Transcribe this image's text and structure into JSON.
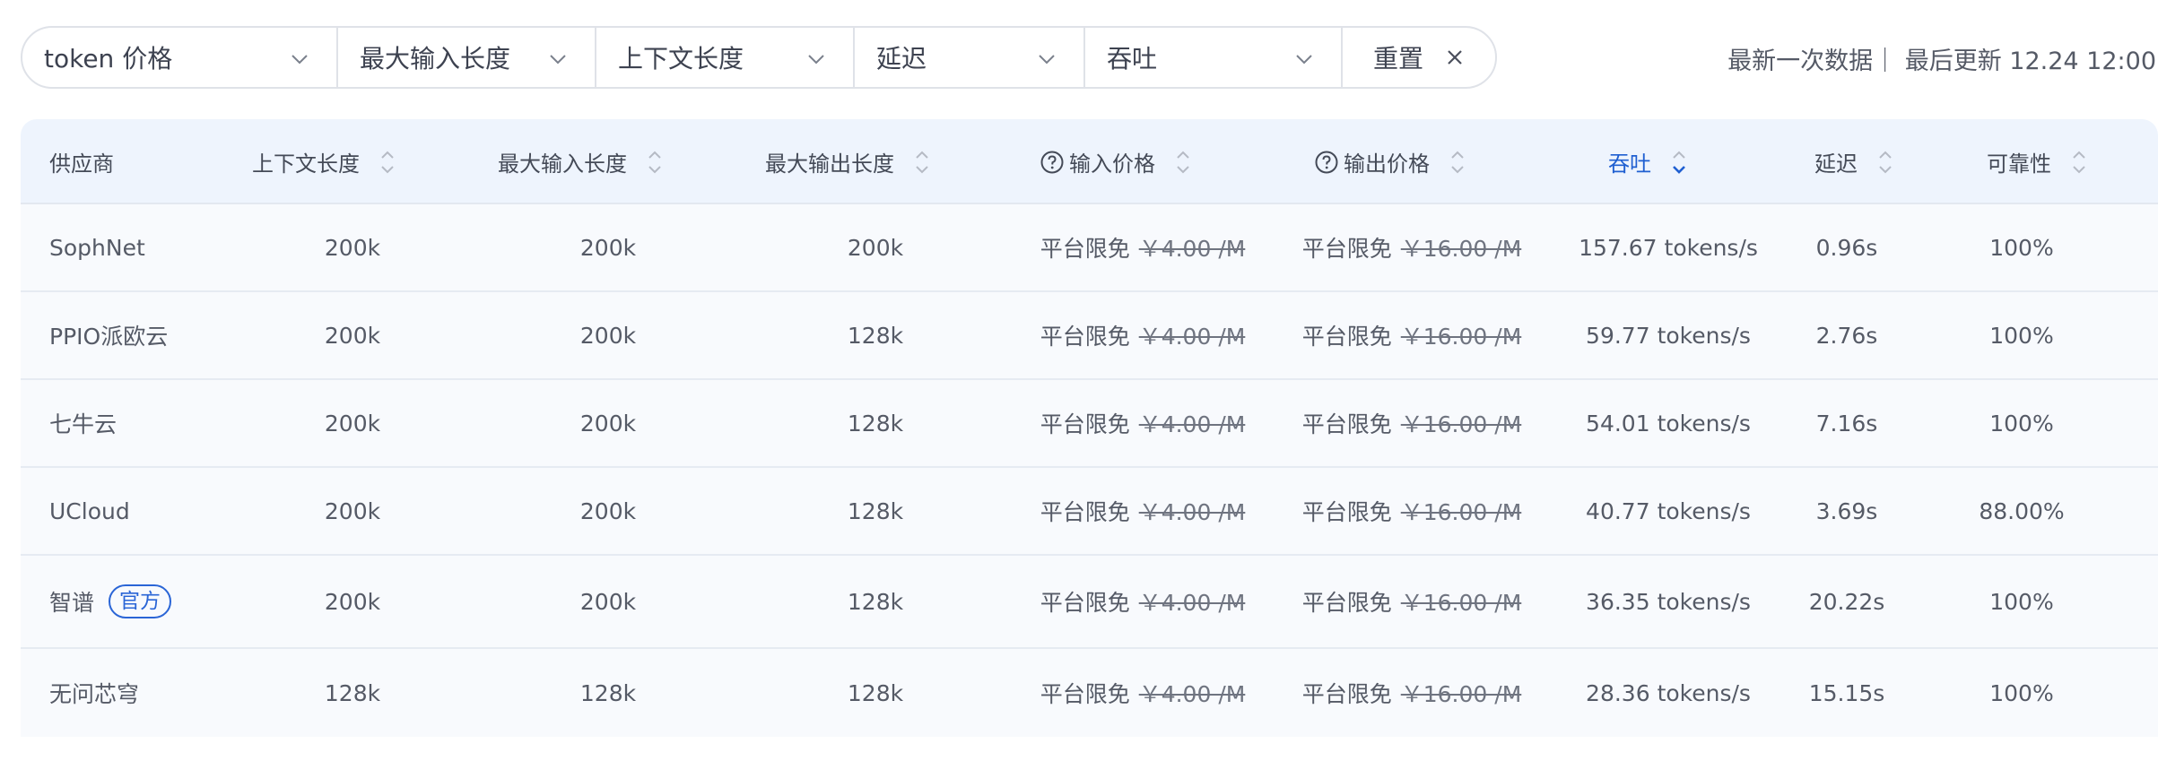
{
  "filters": [
    {
      "label": "token 价格",
      "width": 352
    },
    {
      "label": "最大输入长度",
      "width": 288
    },
    {
      "label": "上下文长度",
      "width": 288
    },
    {
      "label": "延迟",
      "width": 257
    },
    {
      "label": "吞吐",
      "width": 287
    }
  ],
  "reset_label": "重置",
  "meta_text": "最新一次数据｜ 最后更新 12.24 12:00",
  "table": {
    "headers": {
      "provider": "供应商",
      "context": "上下文长度",
      "max_input": "最大输入长度",
      "max_output": "最大输出长度",
      "input_price": "输入价格",
      "output_price": "输出价格",
      "throughput": "吞吐",
      "latency": "延迟",
      "reliability": "可靠性"
    },
    "rows": [
      {
        "provider": "SophNet",
        "badge": "",
        "context": "200k",
        "max_input": "200k",
        "max_output": "200k",
        "input_free": "平台限免",
        "input_price": "￥4.00 /M",
        "output_free": "平台限免",
        "output_price": "￥16.00 /M",
        "throughput": "157.67 tokens/s",
        "latency": "0.96s",
        "reliability": "100%"
      },
      {
        "provider": "PPIO派欧云",
        "badge": "",
        "context": "200k",
        "max_input": "200k",
        "max_output": "128k",
        "input_free": "平台限免",
        "input_price": "￥4.00 /M",
        "output_free": "平台限免",
        "output_price": "￥16.00 /M",
        "throughput": "59.77 tokens/s",
        "latency": "2.76s",
        "reliability": "100%"
      },
      {
        "provider": "七牛云",
        "badge": "",
        "context": "200k",
        "max_input": "200k",
        "max_output": "128k",
        "input_free": "平台限免",
        "input_price": "￥4.00 /M",
        "output_free": "平台限免",
        "output_price": "￥16.00 /M",
        "throughput": "54.01 tokens/s",
        "latency": "7.16s",
        "reliability": "100%"
      },
      {
        "provider": "UCloud",
        "badge": "",
        "context": "200k",
        "max_input": "200k",
        "max_output": "128k",
        "input_free": "平台限免",
        "input_price": "￥4.00 /M",
        "output_free": "平台限免",
        "output_price": "￥16.00 /M",
        "throughput": "40.77 tokens/s",
        "latency": "3.69s",
        "reliability": "88.00%"
      },
      {
        "provider": "智谱",
        "badge": "官方",
        "context": "200k",
        "max_input": "200k",
        "max_output": "128k",
        "input_free": "平台限免",
        "input_price": "￥4.00 /M",
        "output_free": "平台限免",
        "output_price": "￥16.00 /M",
        "throughput": "36.35 tokens/s",
        "latency": "20.22s",
        "reliability": "100%"
      },
      {
        "provider": "无问芯穹",
        "badge": "",
        "context": "128k",
        "max_input": "128k",
        "max_output": "128k",
        "input_free": "平台限免",
        "input_price": "￥4.00 /M",
        "output_free": "平台限免",
        "output_price": "￥16.00 /M",
        "throughput": "28.36 tokens/s",
        "latency": "15.15s",
        "reliability": "100%"
      }
    ]
  },
  "colors": {
    "accent": "#1f5fd1",
    "header_bg": "#eef4fd",
    "row_bg": "#f8fafd",
    "border": "#dfe2e8"
  },
  "icons": {
    "dropdown": "chevron-down-icon",
    "reset": "close-icon",
    "sort": "sort-icon",
    "help": "question-circle-icon"
  }
}
